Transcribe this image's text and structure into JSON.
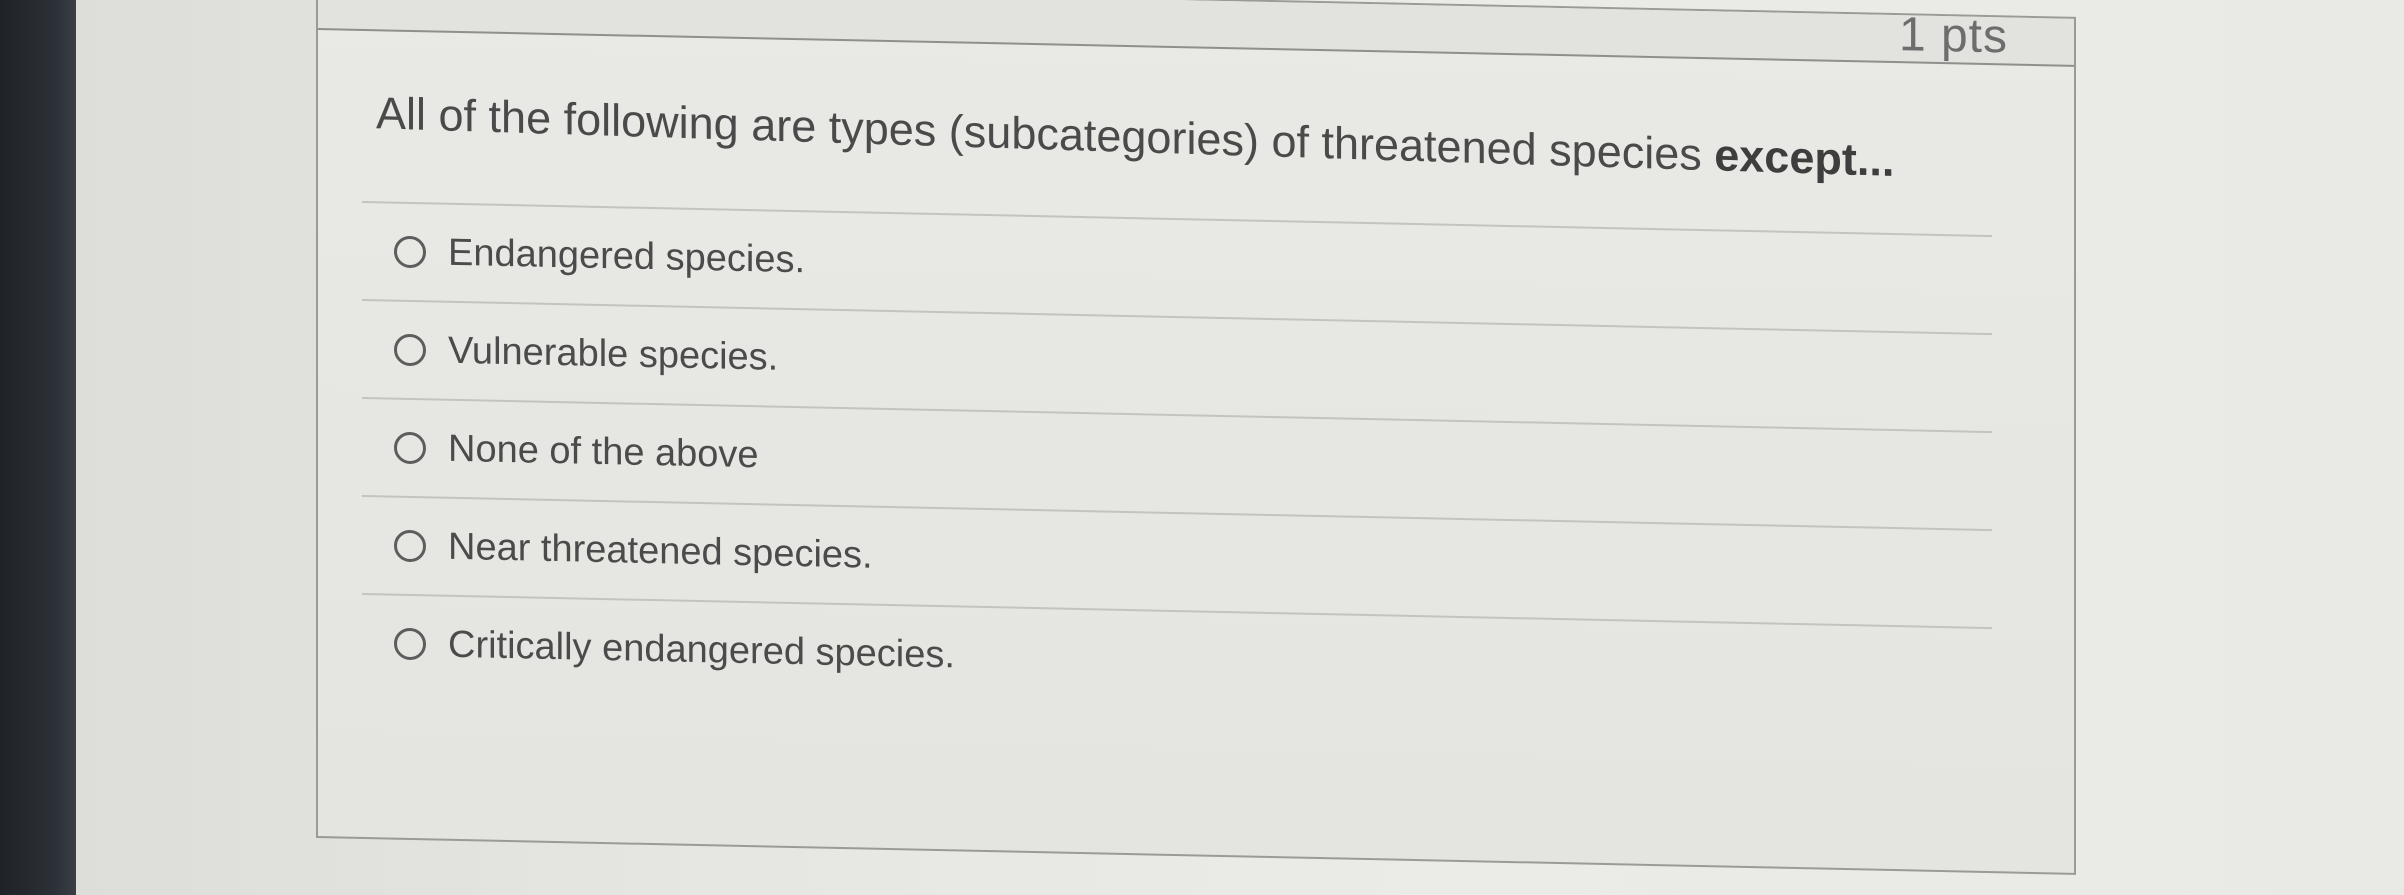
{
  "quiz": {
    "points_label": "1 pts",
    "question": {
      "text": "All of the following are types (subcategories) of threatened species ",
      "emphasis": "except..."
    },
    "answers": [
      {
        "label": "Endangered species."
      },
      {
        "label": "Vulnerable species."
      },
      {
        "label": "None of the above"
      },
      {
        "label": "Near threatened species."
      },
      {
        "label": "Critically endangered species."
      }
    ]
  }
}
